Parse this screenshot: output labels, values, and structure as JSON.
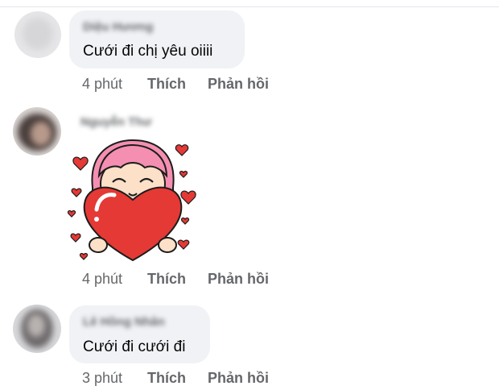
{
  "comments": [
    {
      "author": "Diệu Hương",
      "text": "Cưới đi chị yêu oiiii",
      "time": "4 phút",
      "like_label": "Thích",
      "reply_label": "Phản hồi"
    },
    {
      "author": "Nguyễn Thư",
      "sticker": "girl-holding-heart-sticker",
      "time": "4 phút",
      "like_label": "Thích",
      "reply_label": "Phản hồi"
    },
    {
      "author": "Lê Hồng Nhân",
      "text": "Cưới đi cưới đi",
      "time": "3 phút",
      "like_label": "Thích",
      "reply_label": "Phản hồi"
    }
  ],
  "colors": {
    "bubble": "#f0f2f5",
    "meta_text": "#65676b",
    "heart": "#e53935",
    "hair": "#f48fb1"
  }
}
